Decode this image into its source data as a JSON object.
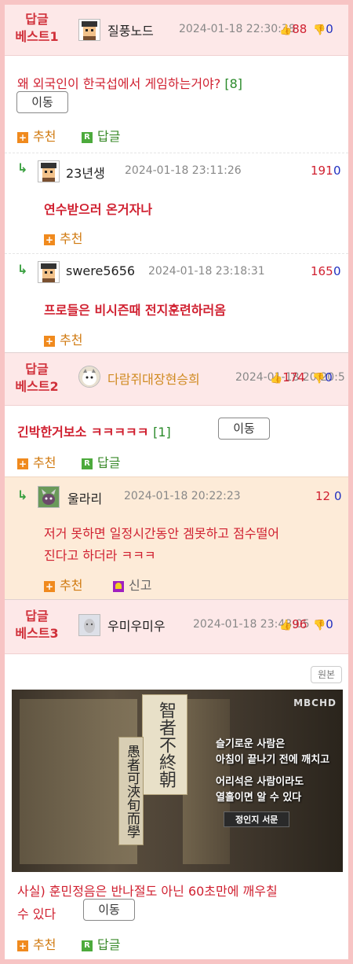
{
  "labels": {
    "best": "답글",
    "recommend": "추천",
    "reply": "답글",
    "move": "이동",
    "report": "신고",
    "original": "원본",
    "thumb_up": "👍",
    "thumb_down": "👎"
  },
  "best1": {
    "rank": "베스트1",
    "nick": "질풍노드",
    "date": "2024-01-18 22:30:38",
    "up": "88",
    "down": "0",
    "title": "왜 외국인이 한국섭에서 게임하는거야?",
    "count": "[8]",
    "replies": [
      {
        "nick": "23년생",
        "date": "2024-01-18 23:11:26",
        "up": "191",
        "down": "0",
        "text": "연수받으러 온거자나"
      },
      {
        "nick": "swere5656",
        "date": "2024-01-18 23:18:31",
        "up": "165",
        "down": "0",
        "text": "프로들은 비시즌때 전지훈련하러옴"
      }
    ]
  },
  "best2": {
    "rank": "베스트2",
    "nick": "다람쥐대장현승희",
    "date": "2024-01-18 20:20:5",
    "up": "174",
    "down": "0",
    "title": "긴박한거보소 ㅋㅋㅋㅋㅋ",
    "count": "[1]",
    "reply": {
      "nick": "울라리",
      "date": "2024-01-18 20:22:23",
      "up": "12",
      "down": "0",
      "line1": "저거 못하면 일정시간동안 겜못하고 점수떨어",
      "line2": "진다고 하더라 ㅋㅋㅋ"
    }
  },
  "best3": {
    "rank": "베스트3",
    "nick": "우미우미우",
    "date": "2024-01-18 23:48:05",
    "up": "96",
    "down": "0",
    "image": {
      "logo": "MBCHD",
      "scroll_title": "智者不終朝",
      "scroll_sub": "愚者可浹旬而學",
      "cap1": "슬기로운 사람은",
      "cap2": "아침이 끝나기 전에 깨치고",
      "cap3": "어리석은 사람이라도",
      "cap4": "열흘이면 알 수 있다",
      "source": "정인지 서문"
    },
    "line1": "사실) 훈민정음은 반나절도 아닌 60초만에 깨우칠",
    "line2": "수 있다"
  },
  "colors": {
    "accent": "#d02030",
    "down": "#2030c0",
    "border": "#f7c4c4",
    "head_bg": "#fde8e8"
  }
}
